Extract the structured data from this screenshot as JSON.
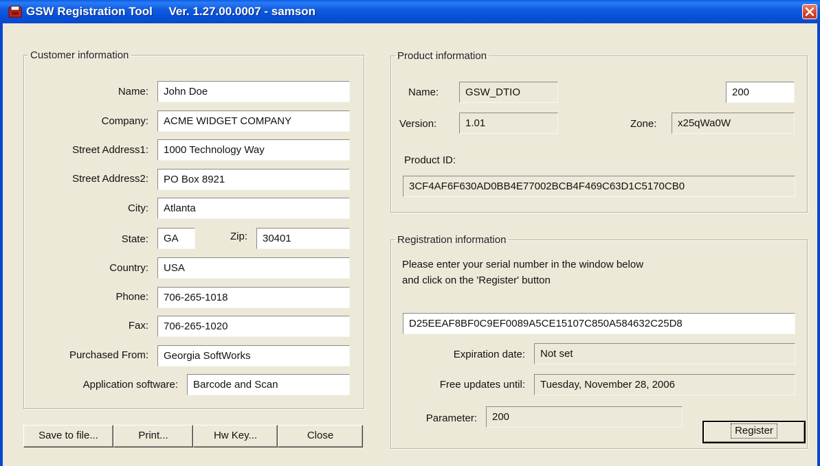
{
  "window": {
    "title": "GSW Registration Tool     Ver. 1.27.00.0007 - samson"
  },
  "customer": {
    "legend": "Customer information",
    "fields": [
      {
        "label": "Name:",
        "value": "John Doe"
      },
      {
        "label": "Company:",
        "value": "ACME WIDGET COMPANY"
      },
      {
        "label": "Street Address1:",
        "value": "1000 Technology Way"
      },
      {
        "label": "Street Address2:",
        "value": "PO Box 8921"
      },
      {
        "label": "City:",
        "value": "Atlanta"
      },
      {
        "label": "State:",
        "value": "GA"
      },
      {
        "label": "Zip:",
        "value": "30401"
      },
      {
        "label": "Country:",
        "value": "USA"
      },
      {
        "label": "Phone:",
        "value": "706-265-1018"
      },
      {
        "label": "Fax:",
        "value": "706-265-1020"
      },
      {
        "label": "Purchased From:",
        "value": "Georgia SoftWorks"
      },
      {
        "label": "Application software:",
        "value": "Barcode and Scan"
      }
    ]
  },
  "buttons": {
    "save": "Save to file...",
    "print": "Print...",
    "hwkey": "Hw Key...",
    "close": "Close",
    "register": "Register"
  },
  "product": {
    "legend": "Product information",
    "name_label": "Name:",
    "name_value": "GSW_DTIO",
    "count_value": "200",
    "version_label": "Version:",
    "version_value": "1.01",
    "zone_label": "Zone:",
    "zone_value": "x25qWa0W",
    "id_label": "Product ID:",
    "id_value": "3CF4AF6F630AD0BB4E77002BCB4F469C63D1C5170CB0"
  },
  "registration": {
    "legend": "Registration information",
    "instructions_line1": "Please enter your serial number in the window below",
    "instructions_line2": "and click on the 'Register' button",
    "serial": "D25EEAF8BF0C9EF0089A5CE15107C850A584632C25D8",
    "expiration_label": "Expiration date:",
    "expiration_value": "Not set",
    "updates_label": "Free updates until:",
    "updates_value": "Tuesday, November 28, 2006",
    "parameter_label": "Parameter:",
    "parameter_value": "200"
  },
  "colors": {
    "titlebar": "#0a5ee6",
    "dialog_bg": "#ece9d8",
    "close_button": "#d6432a"
  }
}
